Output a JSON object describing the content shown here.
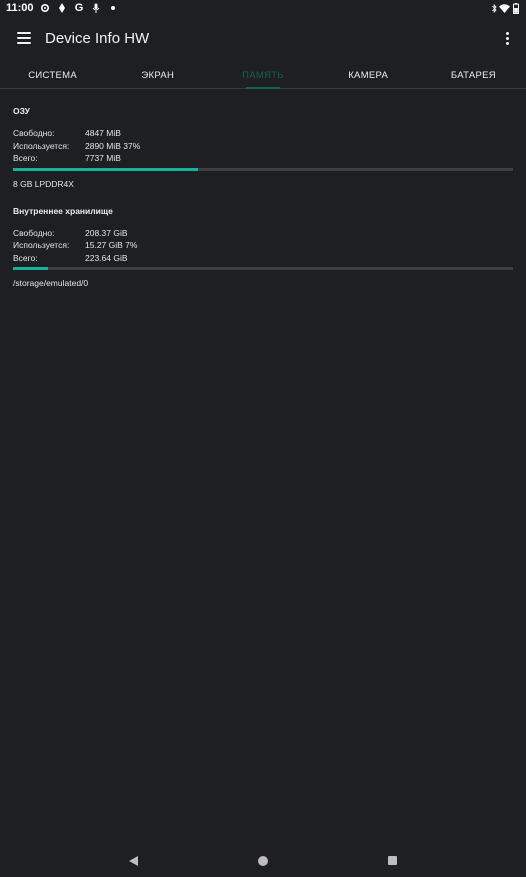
{
  "status_bar": {
    "time": "11:00",
    "left_icons": [
      "settings-icon",
      "location-icon",
      "google-icon",
      "mic-icon",
      "dot-icon"
    ],
    "right_icons": [
      "bluetooth-icon",
      "wifi-icon",
      "battery-icon"
    ]
  },
  "app_bar": {
    "title": "Device Info HW"
  },
  "tabs": [
    {
      "label": "СИСТЕМА",
      "active": false
    },
    {
      "label": "ЭКРАН",
      "active": false
    },
    {
      "label": "ПАМЯТЬ",
      "active": true
    },
    {
      "label": "КАМЕРА",
      "active": false
    },
    {
      "label": "БАТАРЕЯ",
      "active": false
    }
  ],
  "ram": {
    "title": "ОЗУ",
    "free_label": "Свободно:",
    "free_value": "4847 MiB",
    "used_label": "Используется:",
    "used_value": "2890 MiB 37%",
    "total_label": "Всего:",
    "total_value": "7737 MiB",
    "usage_fraction": 0.37,
    "note": "8 GB LPDDR4X"
  },
  "storage": {
    "title": "Внутреннее хранилище",
    "free_label": "Свободно:",
    "free_value": "208.37 GiB",
    "used_label": "Используется:",
    "used_value": "15.27 GiB 7%",
    "total_label": "Всего:",
    "total_value": "223.64 GiB",
    "usage_fraction": 0.07,
    "note": "/storage/emulated/0"
  },
  "colors": {
    "background": "#1e1f22",
    "accent": "#11b39a",
    "active_tab": "#1a5f4f"
  }
}
